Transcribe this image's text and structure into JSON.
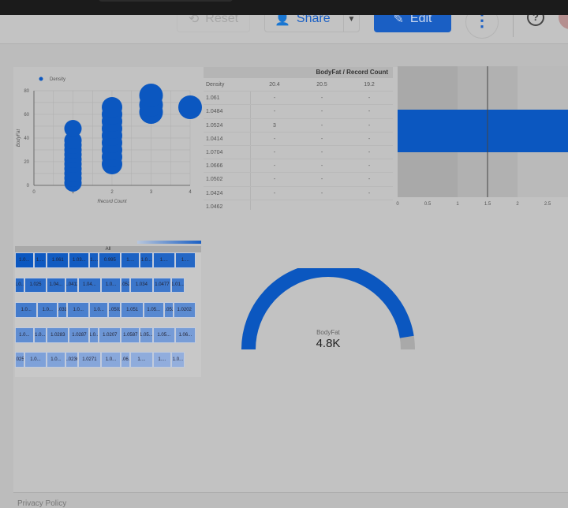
{
  "header": {
    "reset": "Reset",
    "share": "Share",
    "edit": "Edit",
    "more": "⋮",
    "help": "?"
  },
  "footer": {
    "text": "Privacy Policy"
  },
  "colors": {
    "accent": "#1a5fc4",
    "bubble": "#0b57c0"
  },
  "chart_data": [
    {
      "type": "scatter",
      "legend": "Density",
      "xlabel": "Record Count",
      "ylabel": "BodyFat",
      "xlim": [
        0,
        4
      ],
      "ylim": [
        0,
        80
      ],
      "xticks": [
        "0",
        "1",
        "2",
        "3",
        "4"
      ],
      "yticks": [
        "0",
        "20",
        "40",
        "60",
        "80"
      ],
      "points": [
        [
          1,
          2
        ],
        [
          1,
          6
        ],
        [
          1,
          10
        ],
        [
          1,
          14
        ],
        [
          1,
          18
        ],
        [
          1,
          22
        ],
        [
          1,
          26
        ],
        [
          1,
          30
        ],
        [
          1,
          34
        ],
        [
          1,
          38
        ],
        [
          1,
          48
        ],
        [
          2,
          18
        ],
        [
          2,
          24
        ],
        [
          2,
          30
        ],
        [
          2,
          36
        ],
        [
          2,
          42
        ],
        [
          2,
          48
        ],
        [
          2,
          54
        ],
        [
          2,
          60
        ],
        [
          2,
          66
        ],
        [
          3,
          62
        ],
        [
          3,
          68
        ],
        [
          3,
          76
        ],
        [
          4,
          66
        ]
      ]
    },
    {
      "type": "table",
      "title": "BodyFat / Record Count",
      "row_header": "Density",
      "columns": [
        "20.4",
        "20.5",
        "19.2"
      ],
      "rows": [
        [
          "1.061",
          "-",
          "-",
          "-"
        ],
        [
          "1.0484",
          "-",
          "-",
          "-"
        ],
        [
          "1.0524",
          "3",
          "-",
          "-"
        ],
        [
          "1.0414",
          "-",
          "-",
          "-"
        ],
        [
          "1.0704",
          "-",
          "-",
          "-"
        ],
        [
          "1.0666",
          "-",
          "-",
          "-"
        ],
        [
          "1.0502",
          "-",
          "-",
          "-"
        ],
        [
          "1.0424",
          "-",
          "-",
          "-"
        ],
        [
          "1.0462",
          "",
          "",
          ""
        ]
      ]
    },
    {
      "type": "bar",
      "orientation": "horizontal",
      "value": 3.0,
      "reference_line": 1.5,
      "bands": [
        1,
        2
      ],
      "xticks": [
        "0",
        "0.5",
        "1",
        "1.5",
        "2",
        "2.5"
      ],
      "xlim": [
        0,
        2.85
      ]
    },
    {
      "type": "treemap",
      "root": "All",
      "labels": [
        "1.0...",
        "1....",
        "1.061",
        "1.03...",
        "1....",
        "0.995",
        "1....",
        "1.0...",
        "1....",
        "1....",
        "1.0...",
        "1.025",
        "1.04...",
        "1.0412",
        "1.04...",
        "1.0...",
        "1.0524",
        "1.034",
        "1.0477",
        "1.01...",
        "1.0...",
        "1.0...",
        "1.0316",
        "1.0...",
        "1.0...",
        "1.0502",
        "1.051",
        "1.05...",
        "1.052",
        "1.0202",
        "1.0...",
        "1.0...",
        "1.0283",
        "1.0287",
        "1.0...",
        "1.0207",
        "1.0587",
        "1.05...",
        "1.05...",
        "1.06...",
        "1.0254",
        "1.0...",
        "1.0...",
        "1.0236",
        "1.0271",
        "1.0...",
        "1.06...",
        "1....",
        "1....",
        "1.0..."
      ]
    },
    {
      "type": "gauge",
      "label": "BodyFat",
      "value_text": "4.8K",
      "fill_fraction": 0.95
    }
  ]
}
